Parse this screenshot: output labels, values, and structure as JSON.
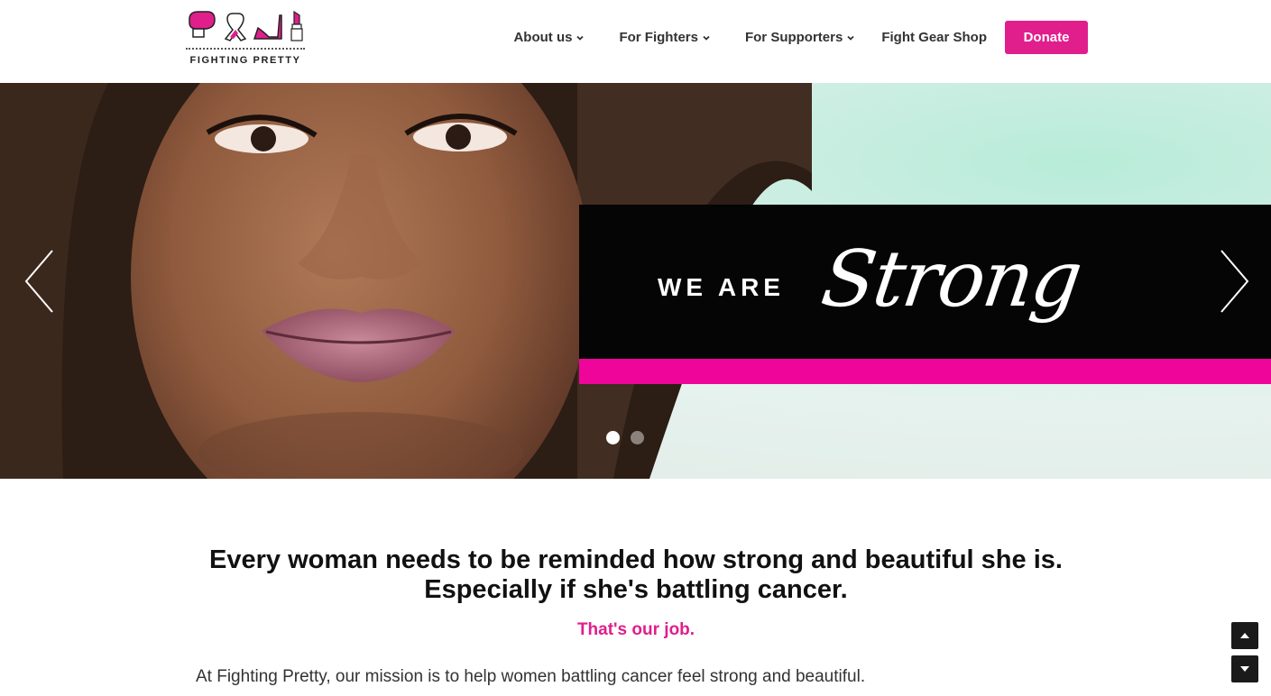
{
  "logo": {
    "text": "FIGHTING PRETTY",
    "brand_color": "#e01e8c"
  },
  "nav": {
    "items": [
      {
        "label": "About us",
        "has_dropdown": true
      },
      {
        "label": "For Fighters",
        "has_dropdown": true
      },
      {
        "label": "For Supporters",
        "has_dropdown": true
      },
      {
        "label": "Fight Gear Shop",
        "has_dropdown": false
      }
    ],
    "donate_label": "Donate"
  },
  "hero": {
    "banner_prefix": "WE ARE",
    "banner_word": "Strong",
    "banner_color": "#050505",
    "stripe_color": "#f0059a",
    "slides_total": 2,
    "active_slide": 1
  },
  "content": {
    "headline": "Every woman needs to be reminded how strong and beautiful she is. Especially if she's battling cancer.",
    "tagline": "That's our job.",
    "mission": "At Fighting Pretty, our mission is to help women battling cancer feel strong and beautiful."
  },
  "icons": [
    "boxing-glove-icon",
    "ribbon-icon",
    "high-heel-icon",
    "lipstick-icon",
    "chevron-down-icon",
    "arrow-left-icon",
    "arrow-right-icon",
    "scroll-up-icon",
    "scroll-down-icon"
  ]
}
